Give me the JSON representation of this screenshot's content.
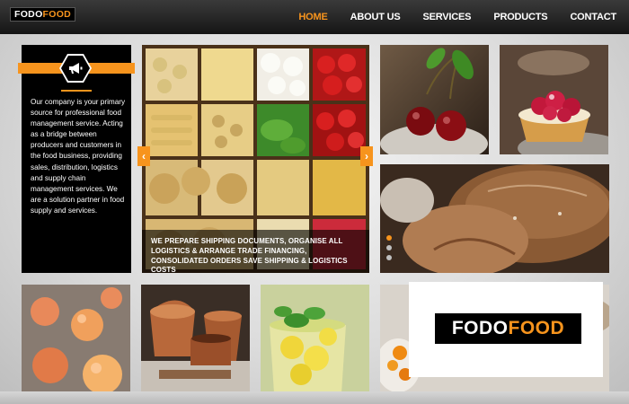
{
  "brand": {
    "logo_white": "FODO",
    "logo_orange": "FOOD"
  },
  "nav": {
    "items": [
      {
        "label": "HOME",
        "active": true
      },
      {
        "label": "ABOUT US",
        "active": false
      },
      {
        "label": "SERVICES",
        "active": false
      },
      {
        "label": "PRODUCTS",
        "active": false
      },
      {
        "label": "CONTACT",
        "active": false
      }
    ]
  },
  "info_panel": {
    "icon": "megaphone-icon",
    "text": "Our company is your primary source for professional food management service. Acting as a bridge between producers and customers in the food business, providing sales, distribution, logistics and supply chain management services. We are a solution partner in food supply and services."
  },
  "slider": {
    "caption": "WE PREPARE SHIPPING DOCUMENTS, ORGANISE ALL LOGISTICS & ARRANGE TRADE FINANCING, CONSOLIDATED ORDERS SAVE SHIPPING & LOGISTICS COSTS",
    "prev_icon": "chevron-left-icon",
    "next_icon": "chevron-right-icon",
    "slide_count": 3,
    "active_slide": 1
  },
  "card_logo": {
    "white": "FODO",
    "orange": "FOOD"
  },
  "colors": {
    "accent": "#f7941d",
    "dark": "#000000",
    "header": "#1e1e1e"
  }
}
